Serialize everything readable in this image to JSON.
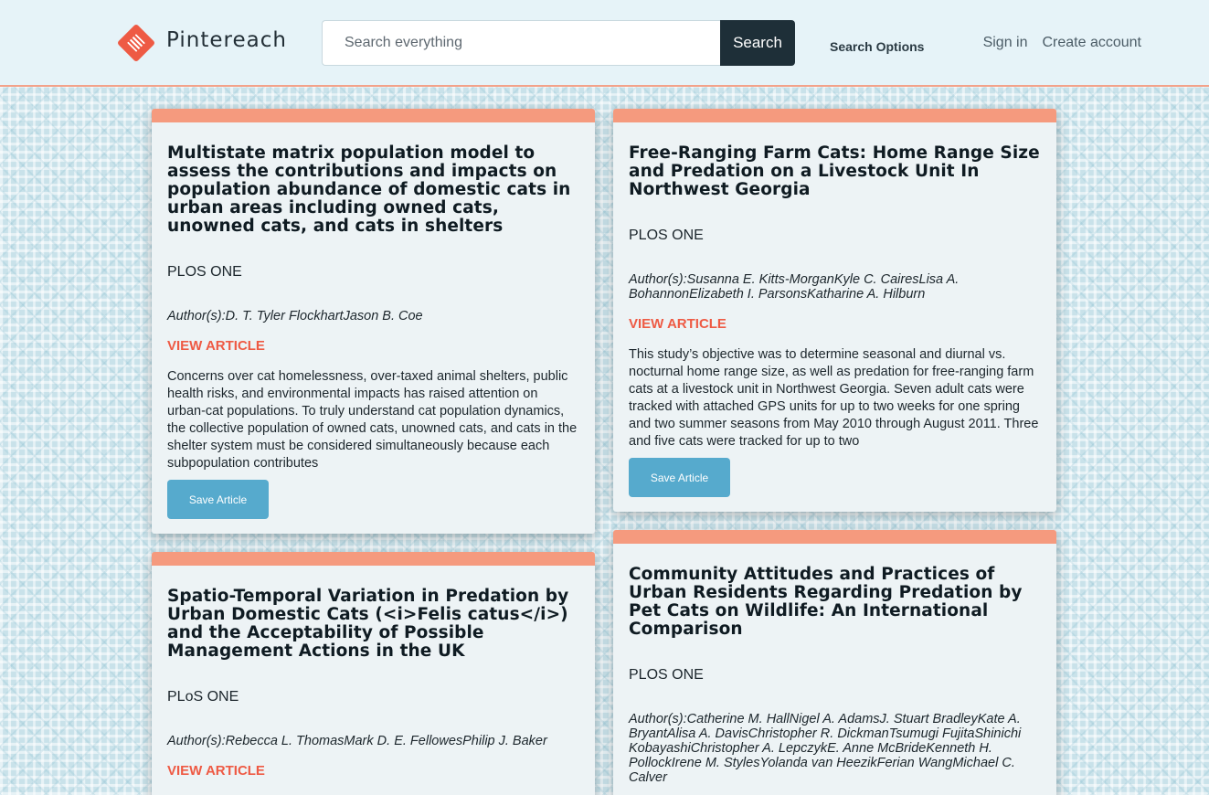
{
  "header": {
    "logo_text": "Pintereach",
    "search_placeholder": "Search everything",
    "search_button": "Search",
    "search_options": "Search Options",
    "sign_in": "Sign in",
    "create_account": "Create account"
  },
  "colors": {
    "accent": "#ee5a44",
    "card_top": "#f59a7e",
    "save_button": "#56aacd",
    "search_button": "#1e2f38"
  },
  "articles": [
    {
      "title": "Multistate matrix population model to assess the contributions and impacts on population abundance of domestic cats in urban areas including owned cats, unowned cats, and cats in shelters",
      "journal": "PLOS ONE",
      "authors": "Author(s):D. T. Tyler FlockhartJason B. Coe",
      "view_label": "VIEW ARTICLE",
      "abstract": "Concerns over cat homelessness, over-taxed animal shelters, public health risks, and environmental impacts has raised attention on urban-cat populations. To truly understand cat population dynamics, the collective population of owned cats, unowned cats, and cats in the shelter system must be considered simultaneously because each subpopulation contributes",
      "save_label": "Save Article"
    },
    {
      "title": "Free-Ranging Farm Cats: Home Range Size and Predation on a Livestock Unit In Northwest Georgia",
      "journal": "PLOS ONE",
      "authors": "Author(s):Susanna E. Kitts-MorganKyle C. CairesLisa A. BohannonElizabeth I. ParsonsKatharine A. Hilburn",
      "view_label": "VIEW ARTICLE",
      "abstract": "This study’s objective was to determine seasonal and diurnal vs. nocturnal home range size, as well as predation for free-ranging farm cats at a livestock unit in Northwest Georgia. Seven adult cats were tracked with attached GPS units for up to two weeks for one spring and two summer seasons from May 2010 through August 2011. Three and five cats were tracked for up to two",
      "save_label": "Save Article"
    },
    {
      "title": "Spatio-Temporal Variation in Predation by Urban Domestic Cats (<i>Felis catus</i>) and the Acceptability of Possible Management Actions in the UK",
      "journal": "PLoS ONE",
      "authors": "Author(s):Rebecca L. ThomasMark D. E. FellowesPhilip J. Baker",
      "view_label": "VIEW ARTICLE"
    },
    {
      "title": "Community Attitudes and Practices of Urban Residents Regarding Predation by Pet Cats on Wildlife: An International Comparison",
      "journal": "PLOS ONE",
      "authors": "Author(s):Catherine M. HallNigel A. AdamsJ. Stuart BradleyKate A. BryantAlisa A. DavisChristopher R. DickmanTsumugi FujitaShinichi KobayashiChristopher A. LepczykE. Anne McBrideKenneth H. PollockIrene M. StylesYolanda van HeezikFerian WangMichael C. Calver"
    }
  ]
}
